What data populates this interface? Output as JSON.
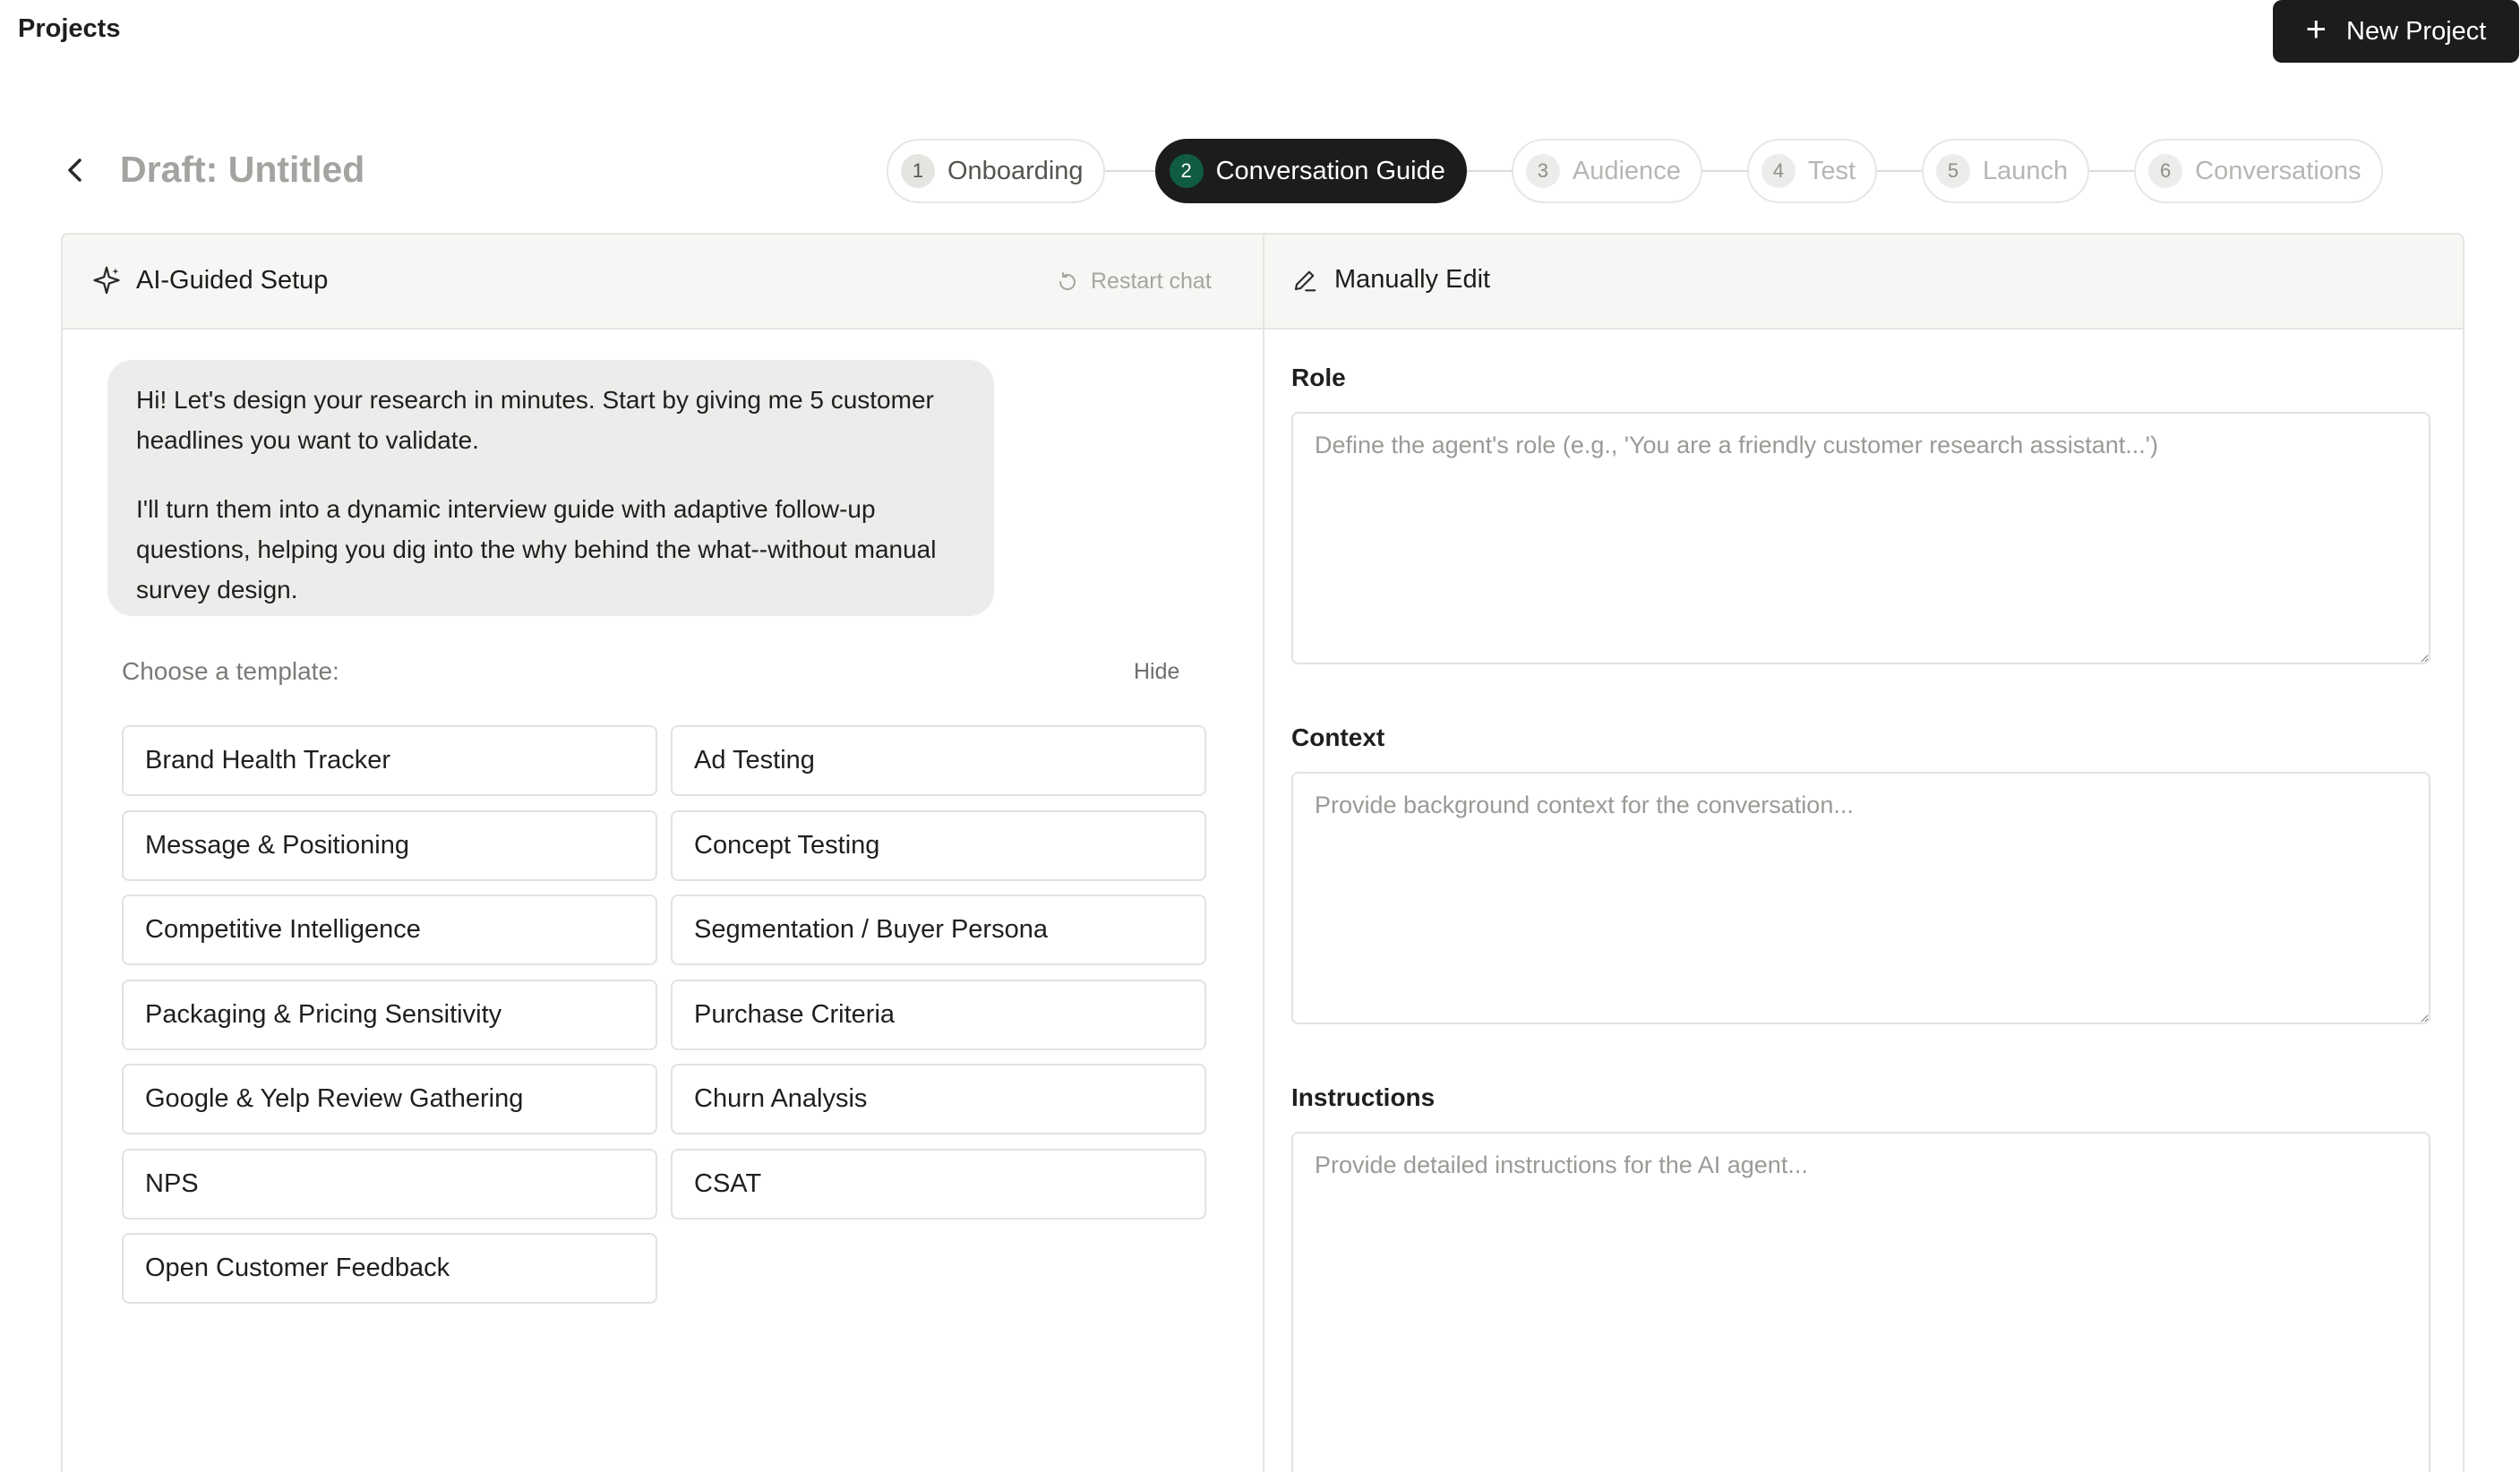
{
  "topbar": {
    "title": "Projects",
    "new_project_label": "New Project"
  },
  "draft": {
    "title": "Draft: Untitled"
  },
  "steps": [
    {
      "number": "1",
      "label": "Onboarding",
      "state": "done"
    },
    {
      "number": "2",
      "label": "Conversation Guide",
      "state": "active"
    },
    {
      "number": "3",
      "label": "Audience",
      "state": "upcoming"
    },
    {
      "number": "4",
      "label": "Test",
      "state": "upcoming"
    },
    {
      "number": "5",
      "label": "Launch",
      "state": "upcoming"
    },
    {
      "number": "6",
      "label": "Conversations",
      "state": "upcoming"
    }
  ],
  "left_panel": {
    "title": "AI-Guided Setup",
    "restart_label": "Restart chat",
    "message_p1": "Hi! Let's design your research in minutes. Start by giving me 5 customer headlines you want to validate.",
    "message_p2": "I'll turn them into a dynamic interview guide with adaptive follow-up questions, helping you dig into the why behind the what--without manual survey design.",
    "choose_label": "Choose a template:",
    "hide_label": "Hide",
    "templates": [
      "Brand Health Tracker",
      "Ad Testing",
      "Message & Positioning",
      "Concept Testing",
      "Competitive Intelligence",
      "Segmentation / Buyer Persona",
      "Packaging & Pricing Sensitivity",
      "Purchase Criteria",
      "Google & Yelp Review Gathering",
      "Churn Analysis",
      "NPS",
      "CSAT",
      "Open Customer Feedback"
    ]
  },
  "right_panel": {
    "title": "Manually Edit",
    "role": {
      "label": "Role",
      "placeholder": "Define the agent's role (e.g., 'You are a friendly customer research assistant...')",
      "value": ""
    },
    "context": {
      "label": "Context",
      "placeholder": "Provide background context for the conversation...",
      "value": ""
    },
    "instructions": {
      "label": "Instructions",
      "placeholder": "Provide detailed instructions for the AI agent...",
      "value": ""
    }
  },
  "colors": {
    "primary_dark": "#1b1c1c",
    "active_step_badge": "#0f5c43",
    "panel_header_bg": "#f6f6f4",
    "chat_bubble_bg": "#ececea"
  }
}
